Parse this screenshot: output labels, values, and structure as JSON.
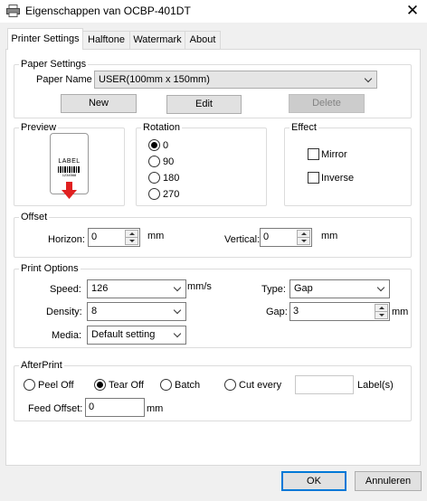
{
  "window": {
    "title": "Eigenschappen van OCBP-401DT",
    "close_glyph": "✕"
  },
  "tabs": [
    {
      "label": "Printer Settings",
      "active": true
    },
    {
      "label": "Halftone"
    },
    {
      "label": "Watermark"
    },
    {
      "label": "About"
    }
  ],
  "paper_settings": {
    "legend": "Paper Settings",
    "paper_name_label": "Paper Name",
    "paper_name_value": "USER(100mm x 150mm)",
    "new_label": "New",
    "edit_label": "Edit",
    "delete_label": "Delete"
  },
  "preview": {
    "legend": "Preview",
    "label_text": "LABEL",
    "barcode_text": "1234568"
  },
  "rotation": {
    "legend": "Rotation",
    "options": [
      "0",
      "90",
      "180",
      "270"
    ],
    "selected": "0"
  },
  "effect": {
    "legend": "Effect",
    "mirror_label": "Mirror",
    "inverse_label": "Inverse"
  },
  "offset": {
    "legend": "Offset",
    "horizon_label": "Horizon:",
    "horizon_value": "0",
    "vertical_label": "Vertical:",
    "vertical_value": "0",
    "unit": "mm"
  },
  "print_options": {
    "legend": "Print Options",
    "speed_label": "Speed:",
    "speed_value": "126",
    "speed_unit": "mm/s",
    "density_label": "Density:",
    "density_value": "8",
    "media_label": "Media:",
    "media_value": "Default setting",
    "type_label": "Type:",
    "type_value": "Gap",
    "gap_label": "Gap:",
    "gap_value": "3",
    "gap_unit": "mm"
  },
  "afterprint": {
    "legend": "AfterPrint",
    "options": [
      "Peel Off",
      "Tear Off",
      "Batch",
      "Cut every"
    ],
    "selected": "Tear Off",
    "cut_every_value": "",
    "labels_suffix": "Label(s)",
    "feed_offset_label": "Feed Offset:",
    "feed_offset_value": "0",
    "feed_offset_unit": "mm"
  },
  "footer": {
    "ok_label": "OK",
    "cancel_label": "Annuleren"
  }
}
